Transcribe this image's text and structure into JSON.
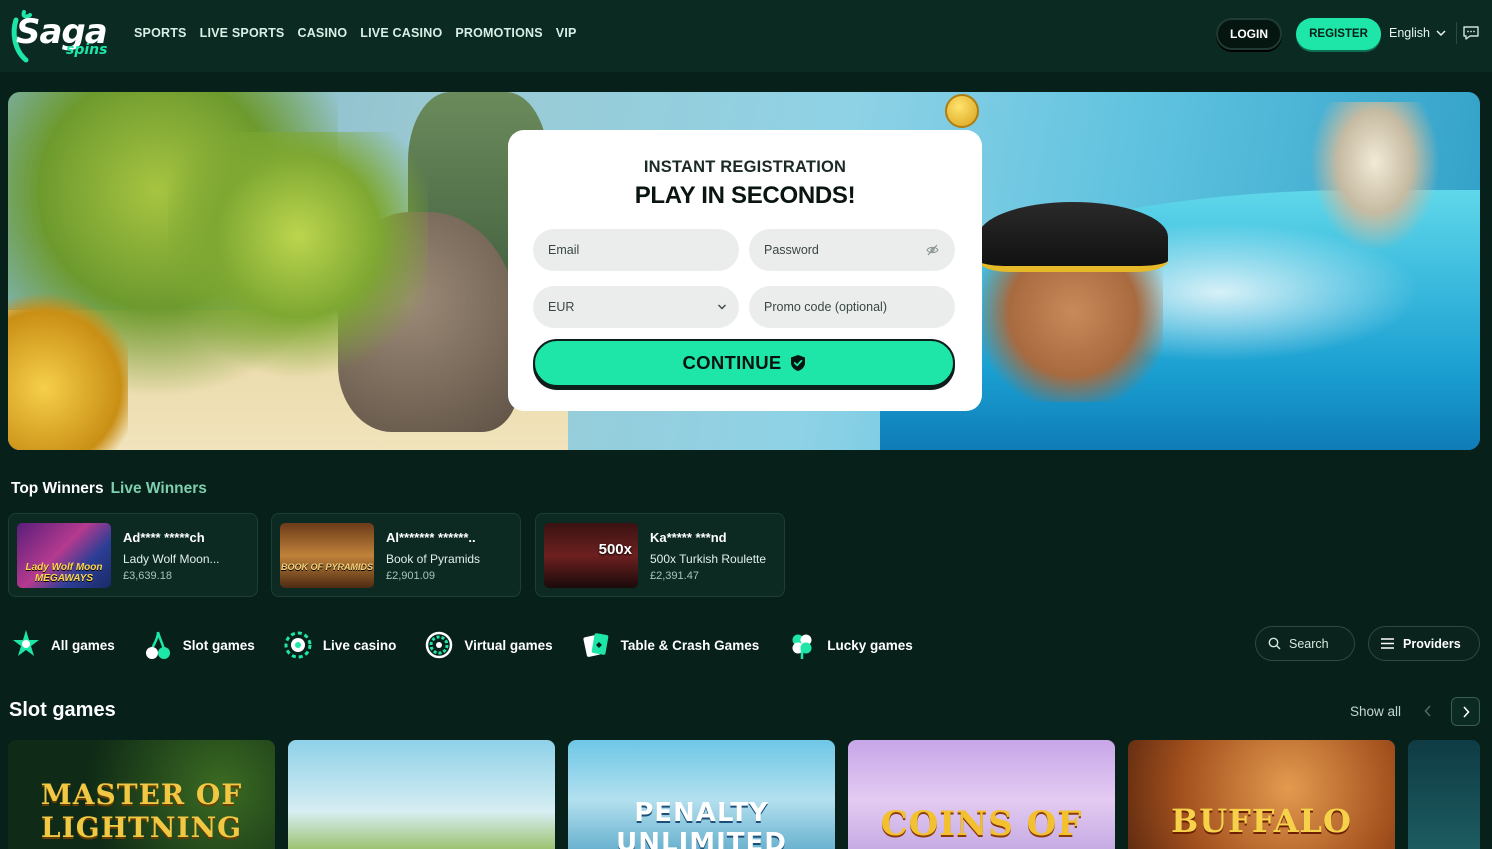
{
  "brand": {
    "logo_main": "Saga",
    "logo_sub": "spins",
    "accent": "#1ee6a8",
    "background": "#07201a"
  },
  "nav": {
    "links": [
      "SPORTS",
      "LIVE SPORTS",
      "CASINO",
      "LIVE CASINO",
      "PROMOTIONS",
      "VIP"
    ],
    "login_label": "LOGIN",
    "register_label": "REGISTER",
    "language": "English"
  },
  "registration": {
    "subtitle": "INSTANT REGISTRATION",
    "title": "PLAY IN SECONDS!",
    "email_placeholder": "Email",
    "password_placeholder": "Password",
    "currency": "EUR",
    "promo_placeholder": "Promo code (optional)",
    "continue_label": "CONTINUE"
  },
  "winners": {
    "tab_top": "Top Winners",
    "tab_live": "Live Winners",
    "items": [
      {
        "name": "Ad**** *****ch",
        "game": "Lady Wolf Moon...",
        "amount": "£3,639.18",
        "thumb_text": "Lady Wolf Moon MEGAWAYS"
      },
      {
        "name": "Al******* ******..",
        "game": "Book of Pyramids",
        "amount": "£2,901.09",
        "thumb_text": "BOOK OF PYRAMIDS"
      },
      {
        "name": "Ka***** ***nd",
        "game": "500x Turkish Roulette",
        "amount": "£2,391.47",
        "thumb_text": "500x"
      }
    ]
  },
  "categories": {
    "items": [
      {
        "label": "All games",
        "icon": "all-games-icon"
      },
      {
        "label": "Slot games",
        "icon": "cherry-icon"
      },
      {
        "label": "Live casino",
        "icon": "roulette-chip-icon"
      },
      {
        "label": "Virtual games",
        "icon": "virtual-chip-icon"
      },
      {
        "label": "Table & Crash Games",
        "icon": "cards-icon"
      },
      {
        "label": "Lucky games",
        "icon": "clover-icon"
      }
    ],
    "search_label": "Search",
    "providers_label": "Providers"
  },
  "slots": {
    "title": "Slot games",
    "show_all": "Show all",
    "games": [
      "MASTER OF LIGHTNING",
      "",
      "PENALTY UNLIMITED",
      "COINS OF ZEUS",
      "BUFFALO",
      ""
    ]
  }
}
